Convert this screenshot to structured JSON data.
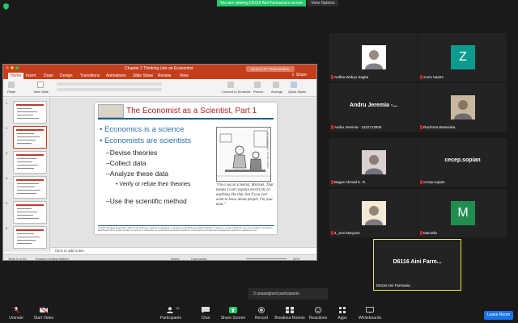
{
  "banner": {
    "text": "You are viewing D6116 Aini Farmania's screen",
    "view_options": "View Options"
  },
  "ppt": {
    "title": "Chapter 2 Thinking Like an Economist",
    "search_placeholder": "Search for Presentation",
    "tabs": [
      "Home",
      "Insert",
      "Draw",
      "Design",
      "Transitions",
      "Animations",
      "Slide Show",
      "Review",
      "View"
    ],
    "share": "Share",
    "ribbon": {
      "paste": "Paste",
      "new_slide": "New Slide",
      "convert": "Convert to SmartArt",
      "picture": "Picture",
      "arrange": "Arrange",
      "quick_styles": "Quick Styles"
    },
    "slide": {
      "title": "The Economist as a Scientist, Part 1",
      "bullets": [
        "Economics is a science",
        "Economists are scientists"
      ],
      "sub_bullets": [
        "Devise theories",
        "Collect data",
        "Analyze these data"
      ],
      "sub_sub": "Verify or refute their theories",
      "last": "Use the scientific method",
      "caption": "\"I'm a social scientist, Michael. That means I can't explain electricity or anything like that, but if you ever want to know about people, I'm your man.\"",
      "cartoon_credit": "© J.B. Handelsman, The New Yorker",
      "copyright": "© 2018 Cengage Learning®. May not be scanned, copied or duplicated, or posted to a publicly accessible website, in whole or in part, except for use as permitted in a license distributed with a certain product or service or otherwise on a password-protected website or school-approved learning management system for classroom use."
    },
    "thumbs": [
      "1",
      "2",
      "3",
      "4",
      "5",
      "6"
    ],
    "notes": "Click to add notes",
    "status": {
      "slide": "Slide 2 of 44",
      "lang": "English (United States)",
      "notes": "Notes",
      "comments": "Comments",
      "zoom": "92%"
    }
  },
  "participants": [
    {
      "name": "Ardhia Wahyu Sagita",
      "type": "photo",
      "bg": "#ffffff"
    },
    {
      "name": "zoom baa04",
      "type": "letter",
      "letter": "Z",
      "bg": "#0e9b8f"
    },
    {
      "name": "Andru Jeremia - 1222713006",
      "type": "text",
      "big": "Andru Jeremia -..."
    },
    {
      "name": "Rachmat Wasaraka",
      "type": "photo",
      "bg": "#c9b8a0"
    },
    {
      "name": "Bagus Ahmad K. R.",
      "type": "photo",
      "bg": "#d9d0d0"
    },
    {
      "name": "cecep.sopian",
      "type": "text",
      "big": "cecep.sopian"
    },
    {
      "name": "4_Jesi Maryane",
      "type": "photo",
      "bg": "#f3e9d7"
    },
    {
      "name": "Marcello",
      "type": "letter",
      "letter": "M",
      "bg": "#1f8e4e"
    },
    {
      "name": "D6116 Aini Farmania",
      "type": "text",
      "big": "D6116 Aini Farm..."
    }
  ],
  "unassigned": "3 unassigned participants",
  "toolbar": {
    "unmute": "Unmute",
    "start_video": "Start Video",
    "participants": "Participants",
    "participants_count": "15",
    "chat": "Chat",
    "share": "Share Screen",
    "record": "Record",
    "breakout": "Breakout Rooms",
    "reactions": "Reactions",
    "apps": "Apps",
    "whiteboards": "Whiteboards",
    "leave": "Leave Room"
  },
  "colors": {
    "accent_green": "#23c96a",
    "ppt_red": "#c43e1c",
    "leave_blue": "#1a73e8",
    "speaker_border": "#e6e64a"
  }
}
